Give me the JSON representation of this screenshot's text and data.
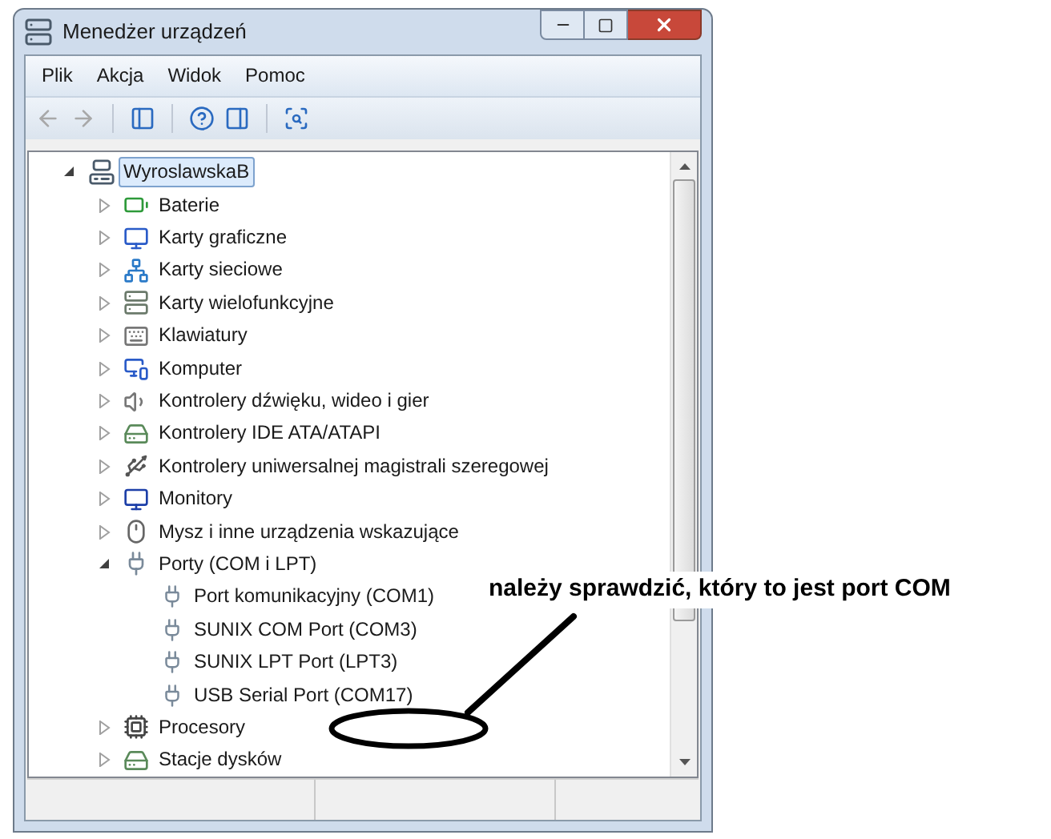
{
  "window": {
    "title": "Menedżer urządzeń"
  },
  "menu": [
    {
      "label": "Plik"
    },
    {
      "label": "Akcja"
    },
    {
      "label": "Widok"
    },
    {
      "label": "Pomoc"
    }
  ],
  "toolbar": [
    {
      "kind": "back",
      "disabled": true
    },
    {
      "kind": "forward",
      "disabled": true
    },
    {
      "kind": "separator"
    },
    {
      "kind": "console",
      "disabled": false
    },
    {
      "kind": "separator"
    },
    {
      "kind": "help",
      "disabled": false
    },
    {
      "kind": "panel",
      "disabled": false
    },
    {
      "kind": "separator"
    },
    {
      "kind": "scan",
      "disabled": false
    }
  ],
  "tree": {
    "label": "WyroslawskaB",
    "expanded": true,
    "selected": true,
    "children": [
      {
        "label": "Baterie",
        "expanded": false,
        "selected": false
      },
      {
        "label": "Karty graficzne",
        "expanded": false,
        "selected": false
      },
      {
        "label": "Karty sieciowe",
        "expanded": false,
        "selected": false
      },
      {
        "label": "Karty wielofunkcyjne",
        "expanded": false,
        "selected": false
      },
      {
        "label": "Klawiatury",
        "expanded": false,
        "selected": false
      },
      {
        "label": "Komputer",
        "expanded": false,
        "selected": false
      },
      {
        "label": "Kontrolery dźwięku, wideo i gier",
        "expanded": false,
        "selected": false
      },
      {
        "label": "Kontrolery IDE ATA/ATAPI",
        "expanded": false,
        "selected": false
      },
      {
        "label": "Kontrolery uniwersalnej magistrali szeregowej",
        "expanded": false,
        "selected": false
      },
      {
        "label": "Monitory",
        "expanded": false,
        "selected": false
      },
      {
        "label": "Mysz i inne urządzenia wskazujące",
        "expanded": false,
        "selected": false
      },
      {
        "label": "Porty (COM i LPT)",
        "expanded": true,
        "selected": false,
        "children": [
          {
            "label": "Port komunikacyjny (COM1)",
            "selected": false
          },
          {
            "label": "SUNIX COM Port (COM3)",
            "selected": false
          },
          {
            "label": "SUNIX LPT Port (LPT3)",
            "selected": false
          },
          {
            "label": "USB Serial Port (COM17)",
            "selected": false
          }
        ]
      },
      {
        "label": "Procesory",
        "expanded": false,
        "selected": false
      },
      {
        "label": "Stacje dysków",
        "expanded": false,
        "selected": false
      }
    ]
  },
  "annotation": {
    "text": "należy sprawdzić, który to jest port COM"
  }
}
